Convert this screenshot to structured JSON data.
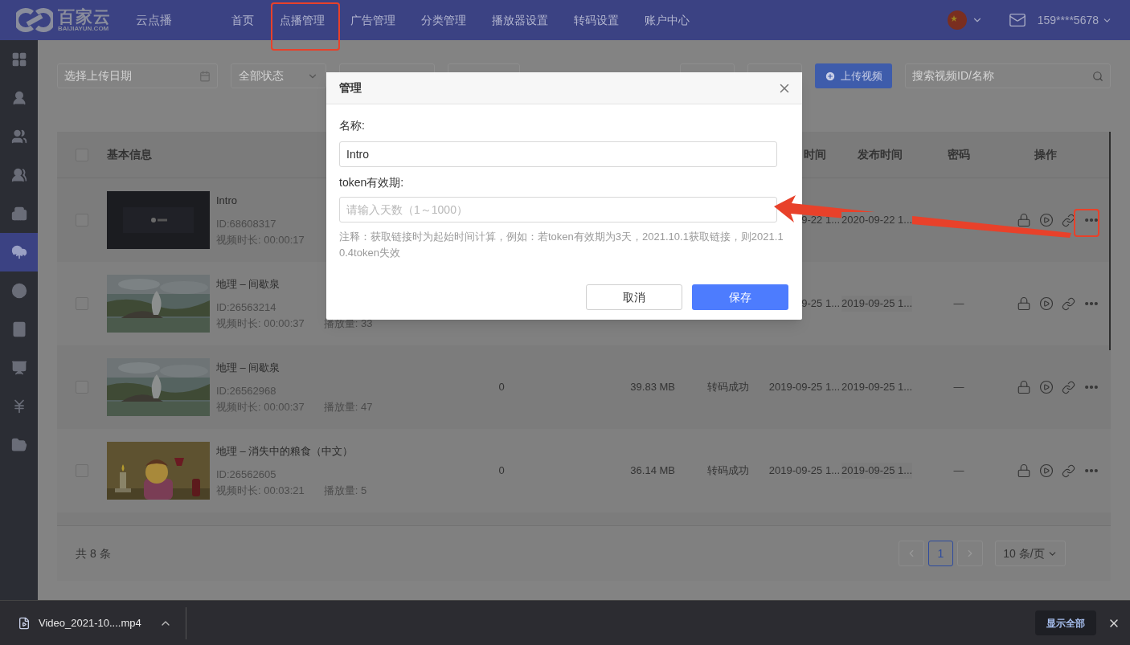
{
  "header": {
    "logo": {
      "name": "百家云",
      "domain": "BAIJIAYUN.COM"
    },
    "product": "云点播",
    "nav": [
      "首页",
      "点播管理",
      "广告管理",
      "分类管理",
      "播放器设置",
      "转码设置",
      "账户中心"
    ],
    "account": "159****5678"
  },
  "sidebar": {
    "items": [
      {
        "selected": false
      },
      {
        "selected": false
      },
      {
        "selected": false
      },
      {
        "selected": false
      },
      {
        "selected": false
      },
      {
        "selected": true
      },
      {
        "selected": false
      },
      {
        "selected": false
      },
      {
        "selected": false
      },
      {
        "selected": false
      },
      {
        "selected": false
      }
    ]
  },
  "toolbar": {
    "date_placeholder": "选择上传日期",
    "status_select": "全部状态",
    "upload_button": "上传视频",
    "search_placeholder": "搜索视频ID/名称"
  },
  "table": {
    "header_checked": false,
    "columns": {
      "info": "基本信息",
      "upload_time": "时间",
      "publish_time": "发布时间",
      "password": "密码",
      "actions": "操作"
    },
    "rows": [
      {
        "checked": false,
        "title": "Intro",
        "id": "ID:68608317",
        "duration": "视频时长: 00:00:17",
        "upload_time": "9-22 1...",
        "publish_time": "2020-09-22 1..."
      },
      {
        "checked": false,
        "title": "地理 – 间歇泉",
        "id": "ID:26563214",
        "duration": "视频时长: 00:00:37",
        "plays": "播放量: 33",
        "upload_time": "9-25 1...",
        "publish_time": "2019-09-25 1...",
        "password": "—"
      },
      {
        "checked": false,
        "title": "地理 – 间歇泉",
        "id": "ID:26562968",
        "duration": "视频时长: 00:00:37",
        "plays": "播放量: 47",
        "column_3": "0",
        "size": "39.83 MB",
        "status": "转码成功",
        "upload_time": "2019-09-25 1...",
        "publish_time": "2019-09-25 1...",
        "password": "—"
      },
      {
        "checked": false,
        "title": "地理 – 消失中的粮食（中文）",
        "id": "ID:26562605",
        "duration": "视频时长: 00:03:21",
        "plays": "播放量: 5",
        "column_3": "0",
        "size": "36.14 MB",
        "status": "转码成功",
        "upload_time": "2019-09-25 1...",
        "publish_time": "2019-09-25 1...",
        "password": "—"
      }
    ]
  },
  "pagination": {
    "total": "共 8 条",
    "pages": [
      {
        "label": "1",
        "selected": true
      }
    ],
    "page_size": "10 条/页"
  },
  "dialog": {
    "title": "管理",
    "name_label": "名称:",
    "name_value": "Intro",
    "token_label": "token有效期:",
    "token_placeholder": "请输入天数（1～1000）",
    "note": "注释：获取链接时为起始时间计算，例如：若token有效期为3天，2021.10.1获取链接，则2021.10.4token失效",
    "cancel": "取消",
    "save": "保存"
  },
  "downloads": {
    "file": "Video_2021-10....mp4",
    "show_all": "显示全部"
  }
}
